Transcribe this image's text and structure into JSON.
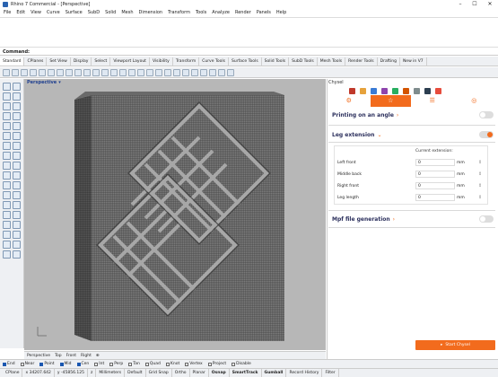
{
  "window": {
    "title": "Rhino 7 Commercial - [Perspective]"
  },
  "menu": [
    "File",
    "Edit",
    "View",
    "Curve",
    "Surface",
    "SubD",
    "Solid",
    "Mesh",
    "Dimension",
    "Transform",
    "Tools",
    "Analyze",
    "Render",
    "Panels",
    "Help"
  ],
  "command": {
    "label": "Command:"
  },
  "toolbar_tabs": [
    "Standard",
    "CPlanes",
    "Set View",
    "Display",
    "Select",
    "Viewport Layout",
    "Visibility",
    "Transform",
    "Curve Tools",
    "Surface Tools",
    "Solid Tools",
    "SubD Tools",
    "Mesh Tools",
    "Render Tools",
    "Drafting",
    "New in V7"
  ],
  "viewport": {
    "label": "Perspective",
    "tabs": [
      "Perspective",
      "Top",
      "Front",
      "Right"
    ]
  },
  "osnaps": [
    {
      "label": "End",
      "on": true
    },
    {
      "label": "Near",
      "on": false
    },
    {
      "label": "Point",
      "on": true
    },
    {
      "label": "Mid",
      "on": true
    },
    {
      "label": "Cen",
      "on": true
    },
    {
      "label": "Int",
      "on": false
    },
    {
      "label": "Perp",
      "on": false
    },
    {
      "label": "Tan",
      "on": false
    },
    {
      "label": "Quad",
      "on": false
    },
    {
      "label": "Knot",
      "on": false
    },
    {
      "label": "Vertex",
      "on": false
    },
    {
      "label": "Project",
      "on": false
    },
    {
      "label": "Disable",
      "on": false
    }
  ],
  "status": {
    "cplane": "CPlane",
    "x": "x 34207.642",
    "y": "y -45856.125",
    "z": "z",
    "units": "Millimeters",
    "layer": "Default",
    "grid_snap": "Grid Snap",
    "ortho": "Ortho",
    "planar": "Planar",
    "osnap": "Osnap",
    "smarttrack": "SmartTrack",
    "gumball": "Gumball",
    "record_history": "Record History",
    "filter": "Filter"
  },
  "panel": {
    "title": "Chysel",
    "printing_angle": {
      "label": "Printing on an angle",
      "on": false
    },
    "leg_extension": {
      "label": "Leg extension",
      "on": true,
      "header": "Current extension:",
      "rows": [
        {
          "name": "Left front",
          "value": "0",
          "unit": "mm"
        },
        {
          "name": "Middle back",
          "value": "0",
          "unit": "mm"
        },
        {
          "name": "Right front",
          "value": "0",
          "unit": "mm"
        },
        {
          "name": "Leg length",
          "value": "0",
          "unit": "mm"
        }
      ]
    },
    "mpf": {
      "label": "Mpf file generation",
      "on": false
    },
    "start_button": "Start Chysel"
  },
  "colors": {
    "accent": "#F26B1D",
    "heading": "#2B2F5C",
    "viewport_bg": "#B7B7B7"
  }
}
